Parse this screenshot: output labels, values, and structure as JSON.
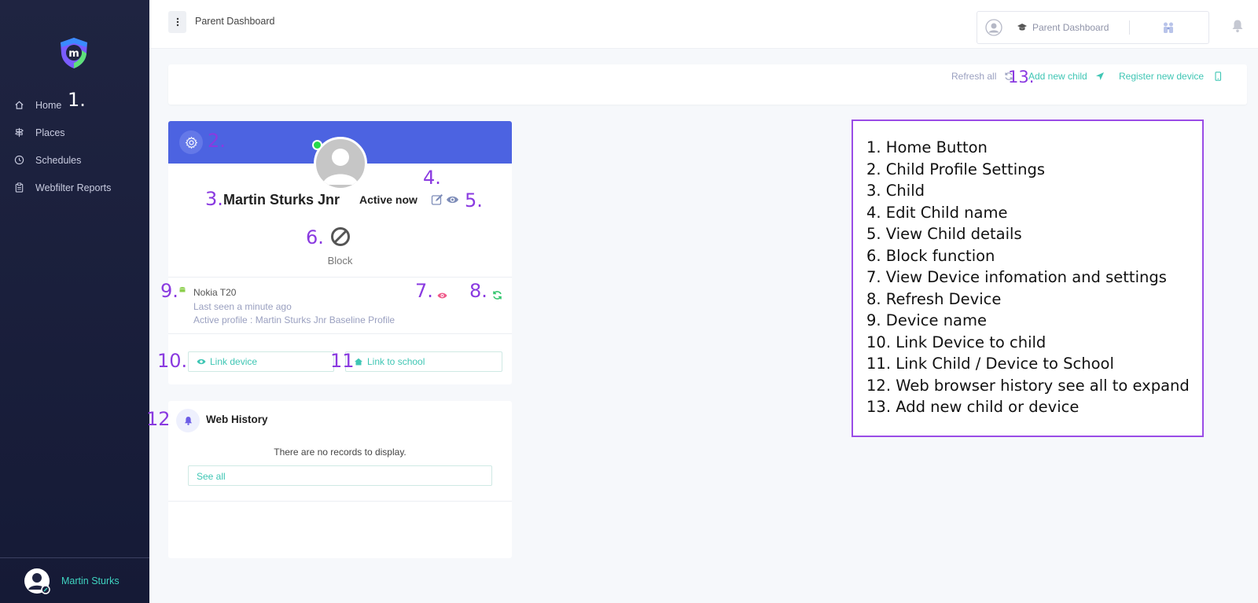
{
  "colors": {
    "sidebar": "#1f2441",
    "accent": "#4c63e1",
    "teal": "#3fc6b4",
    "annotation": "#8a3ae0"
  },
  "sidebar": {
    "logo": "m",
    "items": [
      {
        "label": "Home",
        "icon": "home-icon"
      },
      {
        "label": "Places",
        "icon": "signpost-icon"
      },
      {
        "label": "Schedules",
        "icon": "clock-icon"
      },
      {
        "label": "Webfilter Reports",
        "icon": "clipboard-icon"
      }
    ],
    "user_name": "Martin Sturks"
  },
  "topbar": {
    "title": "Parent Dashboard",
    "switch_label": "Parent Dashboard"
  },
  "actions": {
    "refresh_all": "Refresh all",
    "add_child": "Add new child",
    "register_device": "Register new device"
  },
  "child_card": {
    "name": "Martin Sturks Jnr",
    "status": "Active now",
    "block_label": "Block",
    "device": {
      "name": "Nokia T20",
      "last_seen": "Last seen a minute ago",
      "active_profile": "Active profile : Martin Sturks Jnr Baseline Profile"
    },
    "link_device": "Link device",
    "link_school": "Link to school"
  },
  "web_history": {
    "title": "Web History",
    "empty": "There are no records to display.",
    "see_all": "See all"
  },
  "annotations": {
    "n1": "1.",
    "n2": "2.",
    "n3": "3.",
    "n4": "4.",
    "n5": "5.",
    "n6": "6.",
    "n7": "7.",
    "n8": "8.",
    "n9": "9.",
    "n10": "10.",
    "n11": "11",
    "n12": "12.",
    "n13": "13."
  },
  "legend": [
    "1. Home Button",
    "2. Child Profile Settings",
    "3. Child",
    "4. Edit Child name",
    "5. View Child details",
    "6. Block function",
    "7. View Device infomation and settings",
    "8. Refresh Device",
    "9. Device name",
    "10. Link Device to child",
    "11. Link Child / Device to School",
    "12. Web browser history see all to expand",
    "13. Add new  child or device"
  ]
}
